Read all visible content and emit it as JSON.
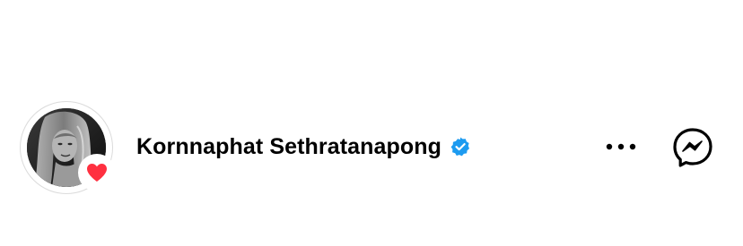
{
  "profile": {
    "name": "Kornnaphat Sethratanapong",
    "verified": true,
    "avatar_icon": "profile-photo",
    "badge_icon": "heart-icon"
  },
  "actions": {
    "more_icon": "more-options-icon",
    "messenger_icon": "messenger-icon"
  },
  "colors": {
    "verified": "#1d9bf0",
    "heart": "#ff3040",
    "text": "#000000"
  }
}
